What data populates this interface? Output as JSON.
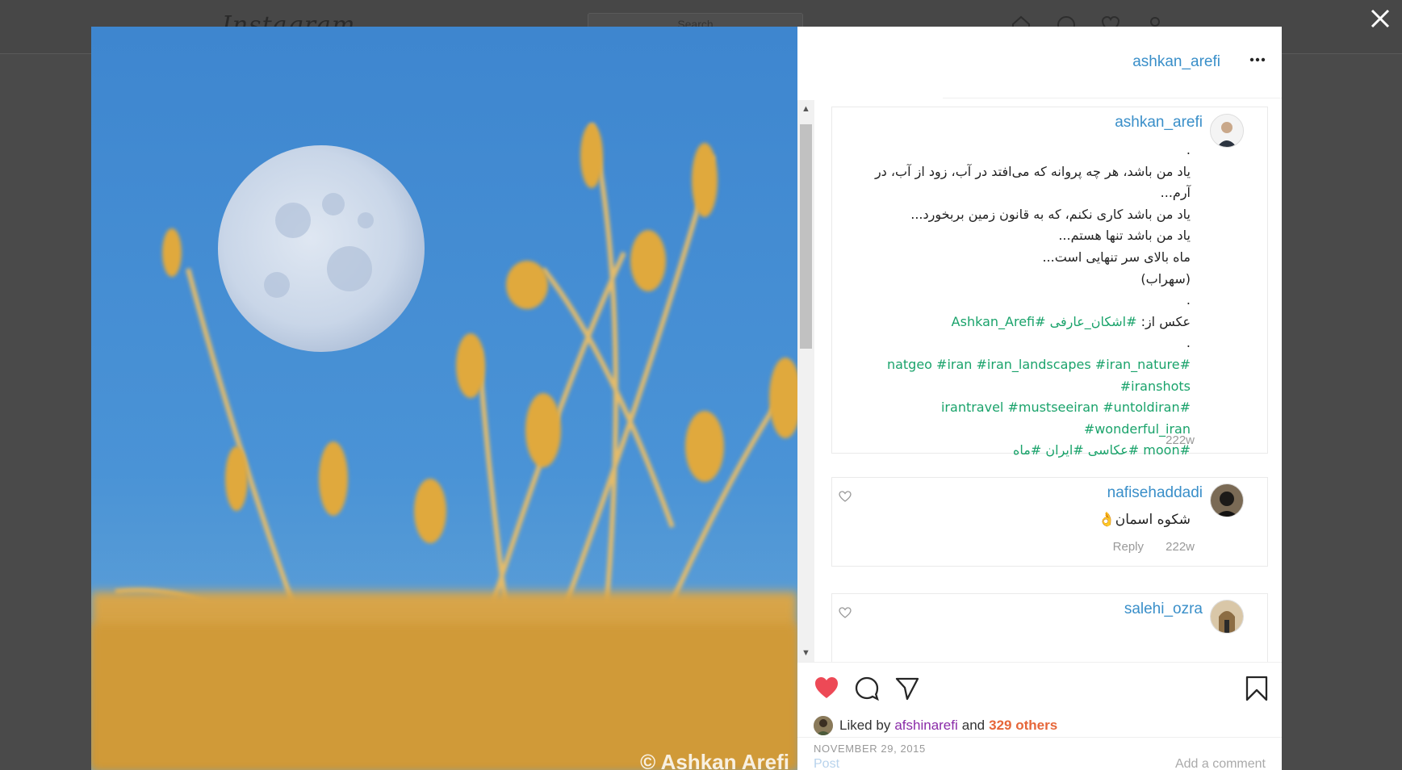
{
  "background": {
    "logo": "Instagram",
    "search_placeholder": "Search"
  },
  "post": {
    "owner": "ashkan_arefi",
    "watermark": "© Ashkan Arefi",
    "caption": {
      "username": "ashkan_arefi",
      "lines": [
        ".",
        "یاد من باشد، هر چه پروانه که می‌افتد در آب، زود از آب، در آرم...",
        "یاد من باشد کاری نکنم، که به قانون زمین بربخورد...",
        "یاد من باشد تنها هستم...",
        "ماه بالای سر تنهایی است...",
        "(سهراب)",
        "."
      ],
      "photo_credit_label": "عکس از:",
      "photo_credit_tags": "#اشکان_عارفی #Ashkan_Arefi",
      "dot": ".",
      "hashtags_line1": "#natgeo #iran #iran_landscapes #iran_nature #iranshots",
      "hashtags_line2": "#irantravel #mustseeiran #untoldiran #wonderful_iran",
      "hashtags_line3": "#moon #عکاسی #ایران #ماه",
      "time": "222w"
    },
    "comments": [
      {
        "username": "nafisehaddadi",
        "text": "شکوه اسمان👌",
        "reply": "Reply",
        "time": "222w"
      },
      {
        "username": "salehi_ozra",
        "text": ""
      }
    ],
    "likes": {
      "prefix": "Liked by",
      "user": "afshinarefi",
      "and": "and",
      "others": "329 others"
    },
    "date": "NOVEMBER 29, 2015",
    "comment_bar": {
      "post_label": "Post",
      "placeholder": "Add a comment"
    },
    "colors": {
      "username": "#3a8fc9",
      "hashtag": "#1aa36b",
      "like_red": "#ed4956",
      "others_orange": "#e6673a"
    }
  }
}
